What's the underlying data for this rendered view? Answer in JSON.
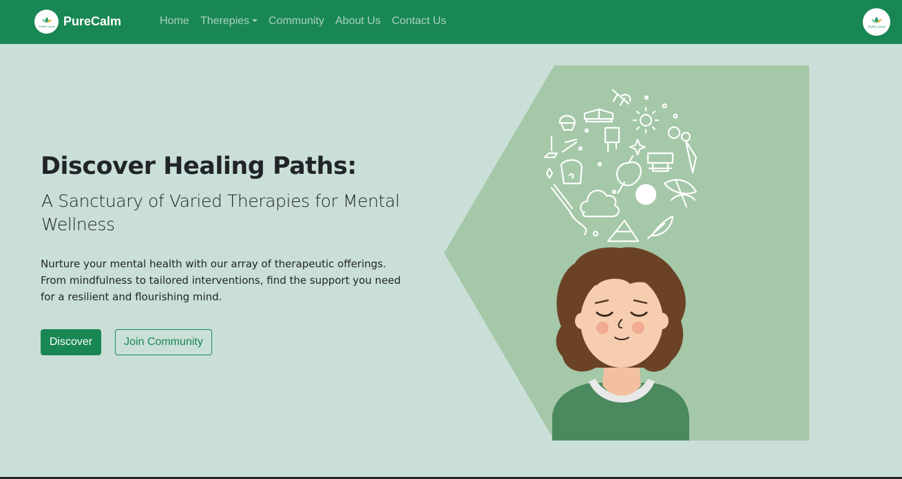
{
  "navbar": {
    "brand_name": "PureCalm",
    "logo_text": "PURE CALM",
    "items": [
      {
        "label": "Home"
      },
      {
        "label": "Therepies"
      },
      {
        "label": "Community"
      },
      {
        "label": "About Us"
      },
      {
        "label": "Contact Us"
      }
    ]
  },
  "hero": {
    "title": "Discover Healing Paths:",
    "subtitle": "A Sanctuary of Varied Therapies for Mental Wellness",
    "description": "Nurture your mental health with our array of therapeutic offerings. From mindfulness to tailored interventions, find the support you need for a resilient and flourishing mind.",
    "primary_button": "Discover",
    "secondary_button": "Join Community"
  },
  "colors": {
    "brand_green": "#198754",
    "page_background": "#cadfd7",
    "illustration_background": "#a5c8a8",
    "sweater_green": "#4a8a5e",
    "hair_brown": "#6b4226",
    "skin": "#f5cba7"
  }
}
